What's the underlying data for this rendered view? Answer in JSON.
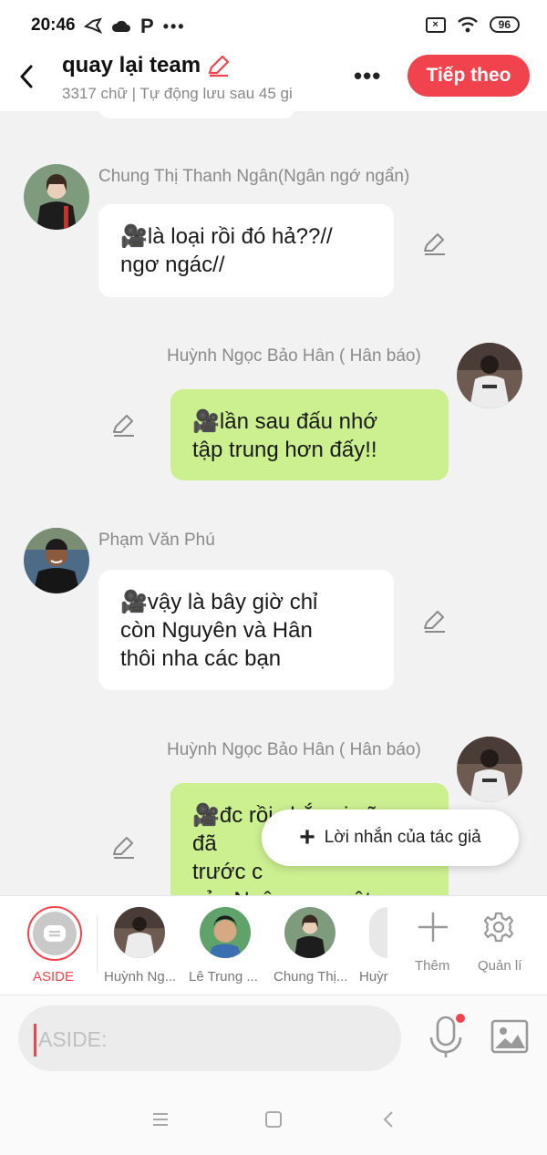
{
  "status_bar": {
    "time": "20:46",
    "battery": "96",
    "p_glyph": "P",
    "dots": "•••"
  },
  "header": {
    "title": "quay lại team",
    "subtitle": "3317 chữ | Tự động lưu sau 45 gi",
    "more": "•••",
    "next_label": "Tiếp theo"
  },
  "messages": [
    {
      "speaker": "Chung Thị Thanh Ngân(Ngân ngớ ngẩn)",
      "text": "🎥là loại rồi đó hả??//\nngơ ngác//",
      "side": "left"
    },
    {
      "speaker": "Huỳnh Ngọc Bảo Hân ( Hân báo)",
      "text": "🎥lần sau đấu nhớ\ntập trung hơn đấy!!",
      "side": "right"
    },
    {
      "speaker": "Phạm Văn Phú",
      "text": "🎥vậy là bây giờ chỉ\ncòn Nguyên và Hân\nthôi nha các bạn",
      "side": "left"
    },
    {
      "speaker": "Huỳnh Ngọc Bảo Hân ( Hân báo)",
      "text": "🎥đc rồi chắc ai cũng đã\ntrước c\ncủa Ngân qua một\nbên",
      "side": "right"
    }
  ],
  "author_note": {
    "plus": "+",
    "label": "Lời nhắn của tác giả"
  },
  "character_bar": {
    "aside_label": "ASIDE",
    "characters": [
      {
        "label": "Huỳnh Ng..."
      },
      {
        "label": "Lê Trung ..."
      },
      {
        "label": "Chung Thị..."
      },
      {
        "label": "Huỳr"
      }
    ],
    "add_label": "Thêm",
    "manage_label": "Quản lí"
  },
  "input": {
    "placeholder": "ASIDE:"
  },
  "colors": {
    "accent": "#f0434d",
    "green_bubble": "#ccef90",
    "background": "#f2f2f2"
  }
}
